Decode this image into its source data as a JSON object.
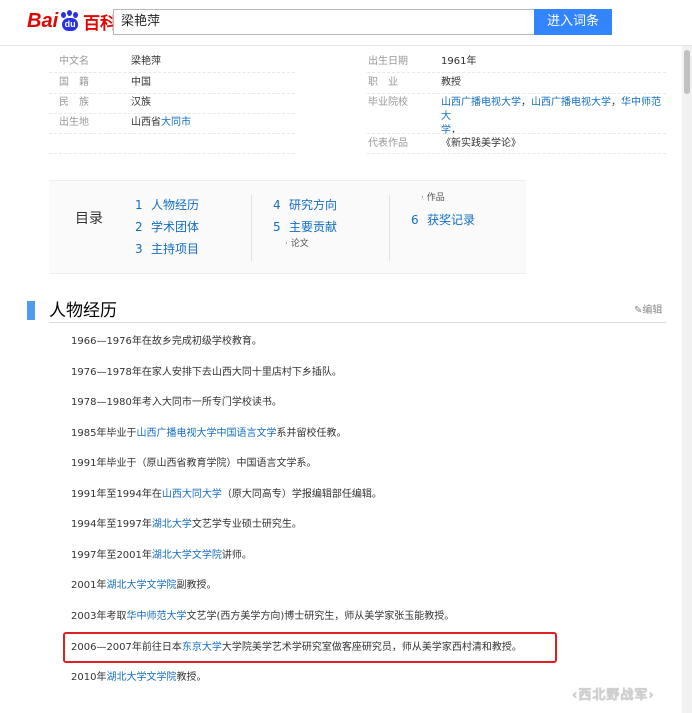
{
  "header": {
    "logo": {
      "bai": "Bai",
      "du": "du",
      "baike": "百科"
    },
    "search_value": "梁艳萍",
    "search_button": "进入词条"
  },
  "basic_info": {
    "left": [
      {
        "label": "中文名",
        "value": "梁艳萍"
      },
      {
        "label": "国　籍",
        "value": "中国"
      },
      {
        "label": "民　族",
        "value": "汉族"
      },
      {
        "label": "出生地",
        "value_prefix": "山西省",
        "value_link": "大同市"
      }
    ],
    "right": [
      {
        "label": "出生日期",
        "value": "1961年"
      },
      {
        "label": "职　业",
        "value": "教授"
      },
      {
        "label": "毕业院校",
        "links": [
          "山西广播电视大学",
          "，",
          "山西广播电视大学",
          "，",
          "华中师范大",
          "学",
          "，"
        ]
      },
      {
        "label": "代表作品",
        "value": "《新实践美学论》"
      }
    ]
  },
  "catalog": {
    "title": "目录",
    "items": [
      {
        "num": "1",
        "label": "人物经历"
      },
      {
        "num": "2",
        "label": "学术团体"
      },
      {
        "num": "3",
        "label": "主持项目"
      },
      {
        "num": "4",
        "label": "研究方向"
      },
      {
        "num": "5",
        "label": "主要贡献"
      },
      {
        "num": "6",
        "label": "获奖记录"
      }
    ],
    "subitems": {
      "lunwen": "论文",
      "zuopin": "作品"
    }
  },
  "section": {
    "title": "人物经历",
    "edit_label": "编辑"
  },
  "paragraphs": [
    {
      "pre": "1966—1976年在故乡完成初级学校教育。",
      "link": "",
      "post": ""
    },
    {
      "pre": "1976—1978年在家人安排下去山西大同十里店村下乡插队。",
      "link": "",
      "post": ""
    },
    {
      "pre": "1978—1980年考入大同市一所专门学校读书。",
      "link": "",
      "post": ""
    },
    {
      "pre": "1985年毕业于",
      "link": "山西广播电视大学中国语言文学",
      "post": "系并留校任教。"
    },
    {
      "pre": "1991年毕业于（原山西省教育学院）中国语言文学系。",
      "link": "",
      "post": ""
    },
    {
      "pre": "1991年至1994年在",
      "link": "山西大同大学",
      "post": "（原大同高专）学报编辑部任编辑。"
    },
    {
      "pre": "1994年至1997年",
      "link": "湖北大学",
      "post": "文艺学专业硕士研究生。"
    },
    {
      "pre": "1997年至2001年",
      "link": "湖北大学文学院",
      "post": "讲师。"
    },
    {
      "pre": "2001年",
      "link": "湖北大学文学院",
      "post": "副教授。"
    },
    {
      "pre": "2003年考取",
      "link": "华中师范大学",
      "post": "文艺学(西方美学方向)博士研究生，师从美学家张玉能教授。"
    },
    {
      "pre": "2006—2007年前往日本",
      "link": "东京大学",
      "post": "大学院美学艺术学研究室做客座研究员，师从美学家西村清和教授。"
    },
    {
      "pre": "2010年",
      "link": "湖北大学文学院",
      "post": "教授。"
    }
  ],
  "watermark": "西北野战军",
  "colors": {
    "accent": "#3385ff",
    "link": "#136ec2",
    "brand_red": "#e10601",
    "section_bar": "#4f9cee",
    "highlight": "#e02020"
  }
}
